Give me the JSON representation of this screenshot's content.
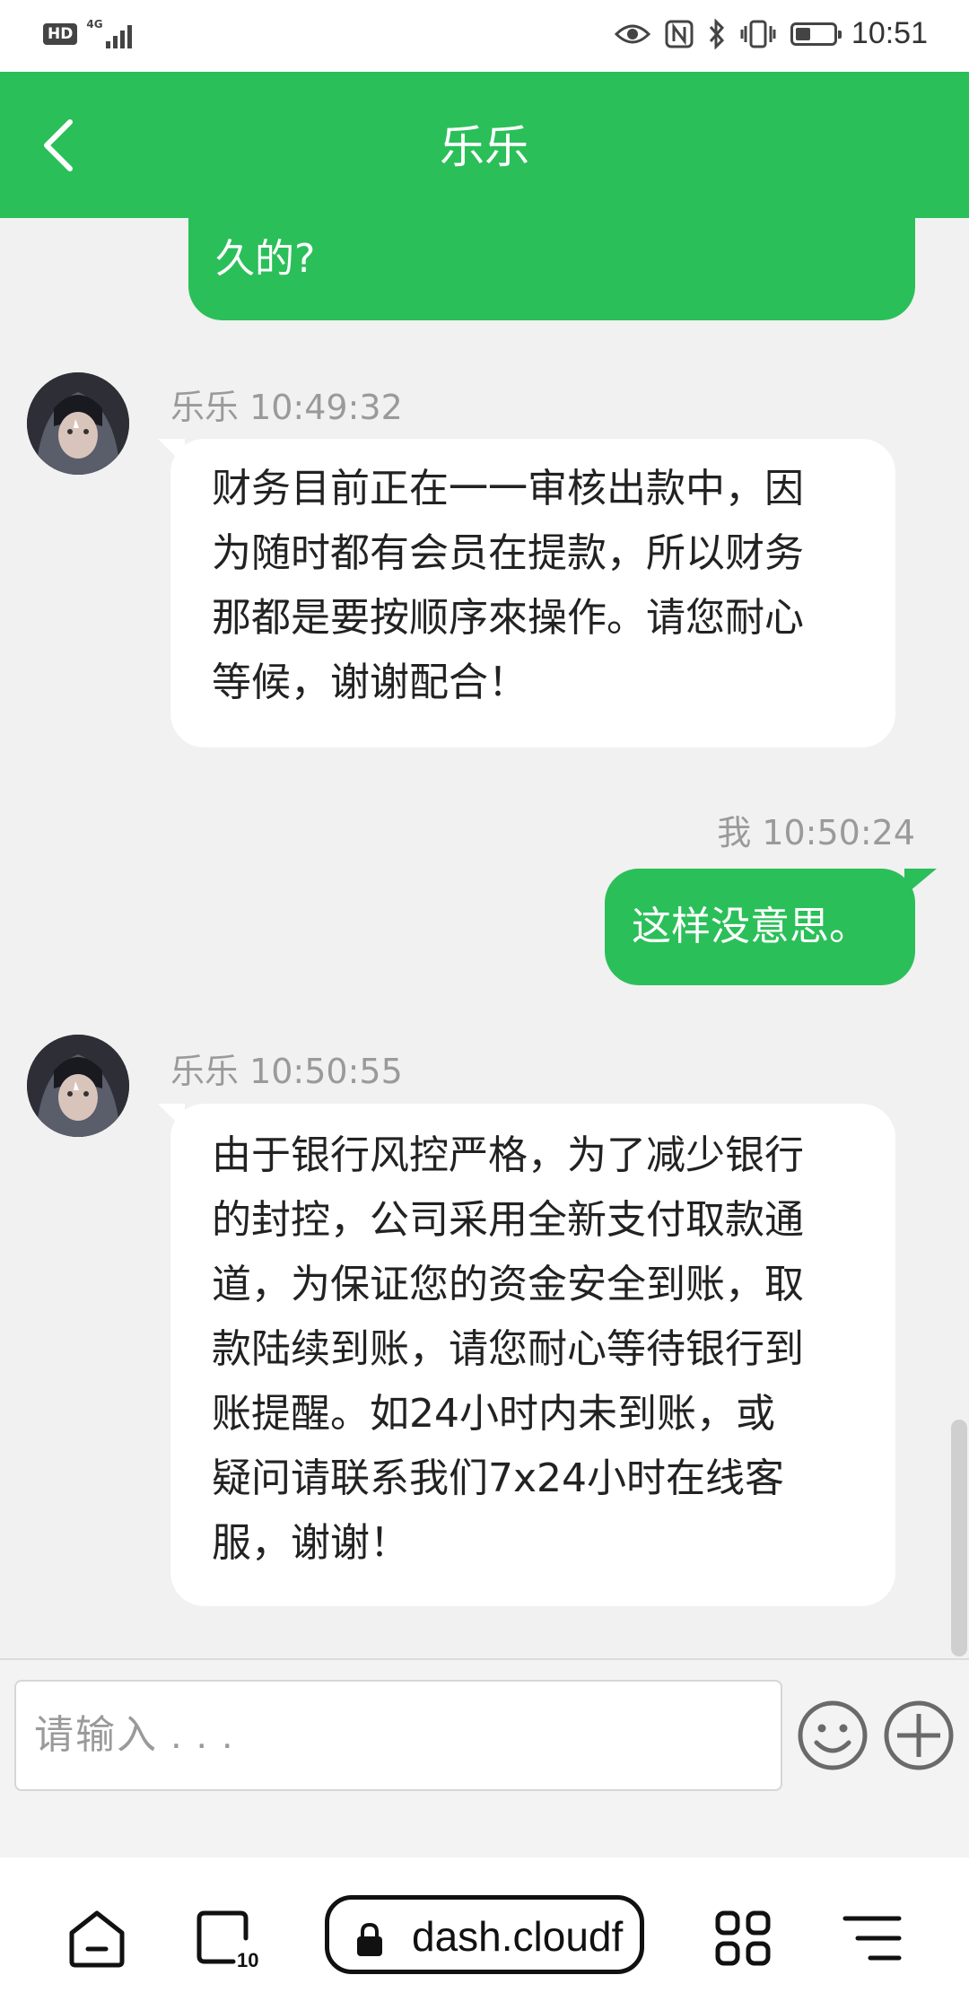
{
  "status_bar": {
    "hd_label": "HD",
    "network_label": "4G",
    "time": "10:51"
  },
  "header": {
    "title": "乐乐"
  },
  "messages": [
    {
      "sender": "me",
      "lines": [
        "久的?"
      ]
    },
    {
      "sender": "乐乐",
      "meta": "乐乐 10:49:32",
      "lines": [
        "财务目前正在一一审核出款中，因",
        "为随时都有会员在提款，所以财务",
        "那都是要按顺序來操作。请您耐心",
        "等候，谢谢配合！"
      ]
    },
    {
      "sender": "me",
      "meta": "我 10:50:24",
      "lines": [
        "这样没意思。"
      ]
    },
    {
      "sender": "乐乐",
      "meta": "乐乐 10:50:55",
      "lines": [
        "由于银行风控严格，为了减少银行",
        "的封控，公司采用全新支付取款通",
        "道，为保证您的资金安全到账，取",
        "款陆续到账，请您耐心等待银行到",
        "账提醒。如24小时内未到账，或",
        "疑问请联系我们7x24小时在线客",
        "服，谢谢！"
      ]
    }
  ],
  "input": {
    "placeholder": "请输入 . . ."
  },
  "browser": {
    "url": "dash.cloudf",
    "tab_count": "10"
  },
  "colors": {
    "brand_green": "#2bbf59",
    "incoming_bubble": "#ffffff",
    "background": "#f1f1f1"
  },
  "icons": [
    "back-arrow-icon",
    "emoji-icon",
    "plus-circle-icon",
    "home-icon",
    "tabs-icon",
    "lock-icon",
    "apps-grid-icon",
    "menu-icon",
    "eye-icon",
    "nfc-icon",
    "bluetooth-icon",
    "vibrate-icon",
    "battery-icon",
    "signal-icon"
  ]
}
